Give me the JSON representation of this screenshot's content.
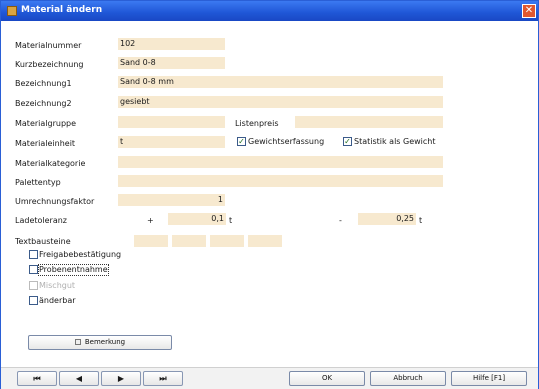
{
  "window": {
    "title": "Material ändern",
    "close_icon": "close-icon"
  },
  "form": {
    "materialnummer": {
      "label": "Materialnummer",
      "value": "102"
    },
    "kurzbezeichnung": {
      "label": "Kurzbezeichnung",
      "value": "Sand 0-8"
    },
    "bezeichnung1": {
      "label": "Bezeichnung1",
      "value": "Sand 0-8 mm"
    },
    "bezeichnung2": {
      "label": "Bezeichnung2",
      "value": "gesiebt"
    },
    "materialgruppe": {
      "label": "Materialgruppe",
      "value": ""
    },
    "listenpreis": {
      "label": "Listenpreis",
      "value": ""
    },
    "materialeinheit": {
      "label": "Materialeinheit",
      "value": "t"
    },
    "gewichtserfassung": {
      "label": "Gewichtserfassung",
      "checked": true
    },
    "statistik": {
      "label": "Statistik als Gewicht",
      "checked": true
    },
    "materialkategorie": {
      "label": "Materialkategorie",
      "value": ""
    },
    "palettentyp": {
      "label": "Palettentyp",
      "value": ""
    },
    "umrechnungsfaktor": {
      "label": "Umrechnungsfaktor",
      "value": "1"
    },
    "ladetoleranz": {
      "label": "Ladetoleranz",
      "plus_sign": "+",
      "plus_value": "0,1",
      "plus_unit": "t",
      "minus_sign": "-",
      "minus_value": "0,25",
      "minus_unit": "t"
    },
    "textbausteine": {
      "label": "Textbausteine",
      "values": [
        "",
        "",
        "",
        ""
      ]
    }
  },
  "checkboxes": [
    {
      "label": "Freigabebestätigung",
      "checked": false,
      "disabled": false
    },
    {
      "label": "Probenentnahme",
      "checked": false,
      "disabled": false
    },
    {
      "label": "Mischgut",
      "checked": false,
      "disabled": true
    },
    {
      "label": "änderbar",
      "checked": false,
      "disabled": false
    }
  ],
  "bemerkung_button": "Bemerkung",
  "nav": {
    "first": "⏮",
    "prev": "◀",
    "next": "▶",
    "last": "⏭"
  },
  "buttons": {
    "ok": "OK",
    "abbruch": "Abbruch",
    "hilfe": "Hilfe [F1]"
  },
  "colors": {
    "field_bg": "#f7e9cf",
    "title_bar": "#1f56d6"
  }
}
